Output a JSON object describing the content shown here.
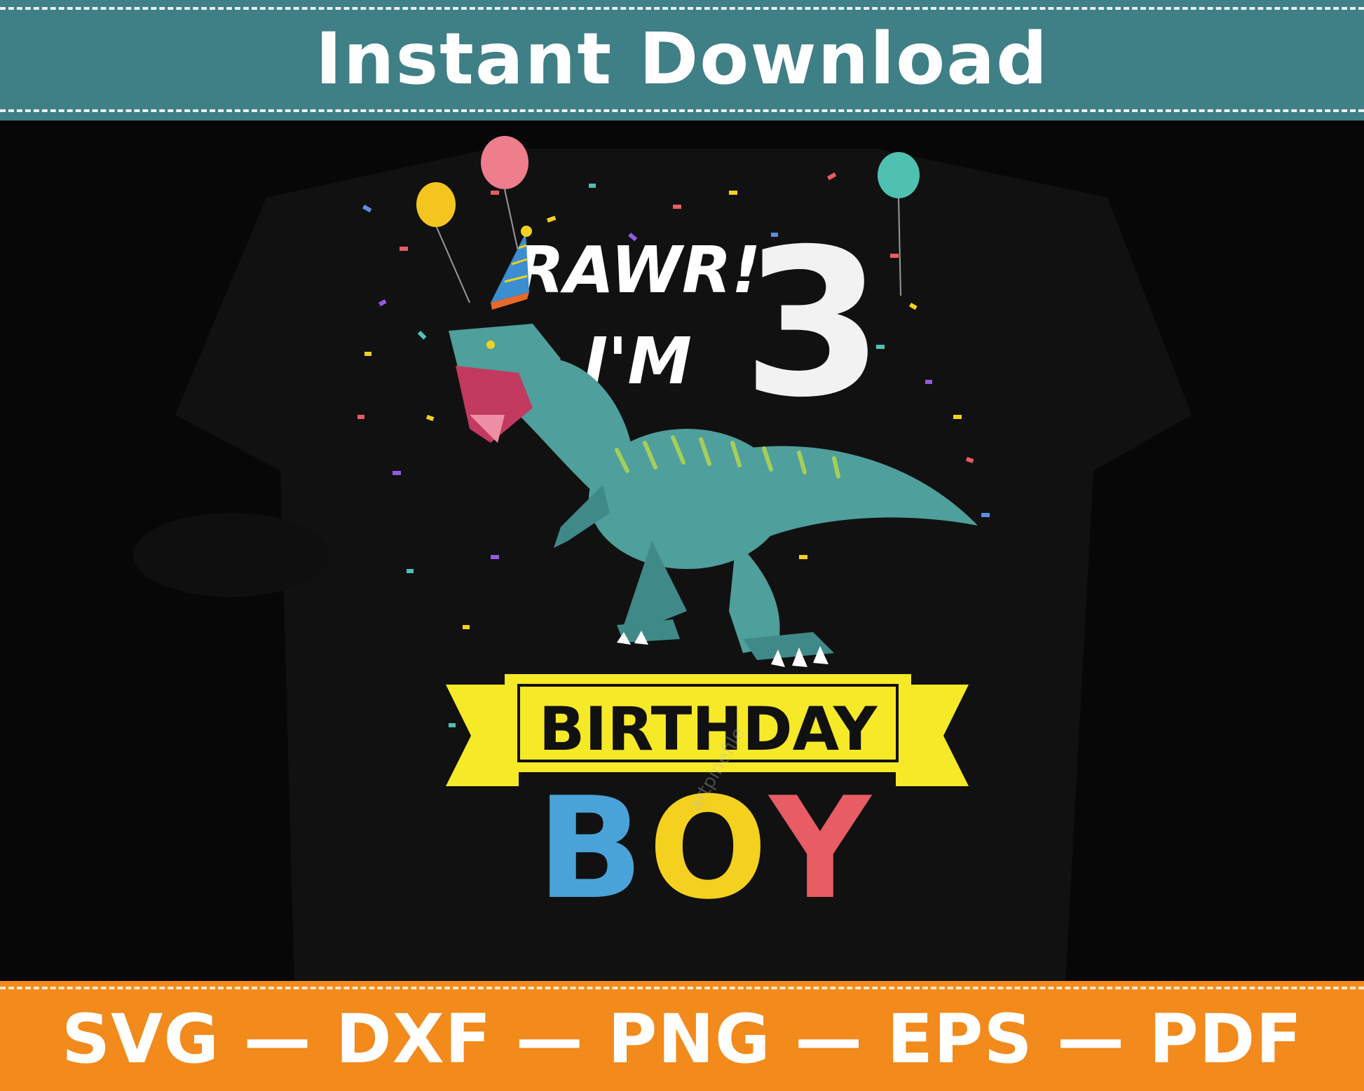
{
  "header": {
    "title": "Instant Download"
  },
  "design": {
    "line1": "RAWR!",
    "line2": "I'M",
    "age": "3",
    "ribbon_text": "BIRTHDAY",
    "boy_letters": [
      "B",
      "O",
      "Y"
    ],
    "watermark": "artpinefile"
  },
  "footer": {
    "formats": "SVG — DXF — PNG — EPS — PDF"
  },
  "colors": {
    "top_banner": "#3f7f86",
    "bottom_banner": "#f28a1c",
    "ribbon": "#f6e927",
    "boy_b": "#4aa3d8",
    "boy_o": "#f4d11f",
    "boy_y": "#e85c63",
    "dino": "#4f9f9c"
  }
}
